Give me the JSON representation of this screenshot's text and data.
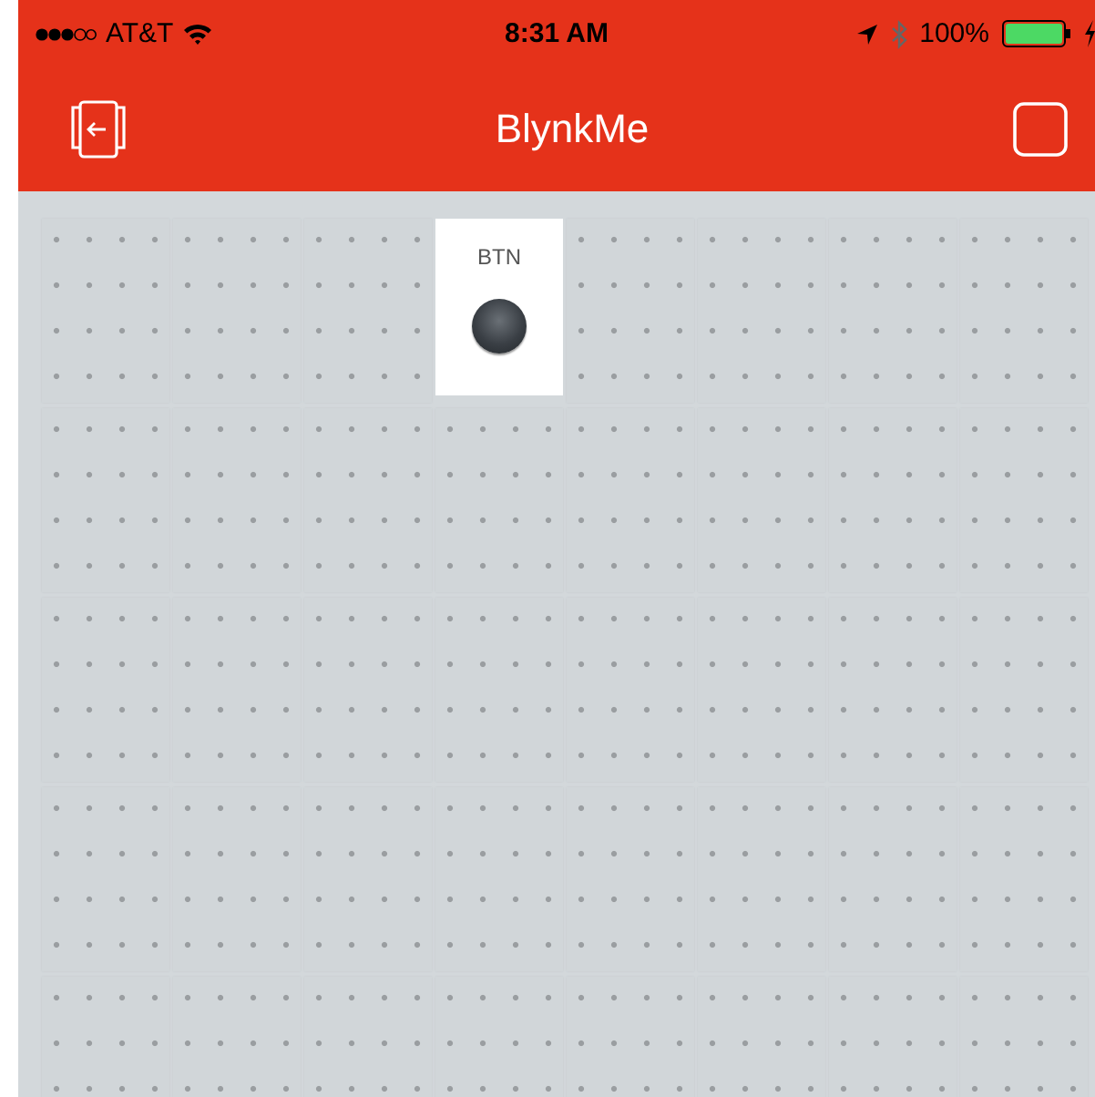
{
  "status_bar": {
    "carrier": "AT&T",
    "time": "8:31 AM",
    "battery": "100%"
  },
  "header": {
    "title": "BlynkMe"
  },
  "grid": {
    "cells": [
      {
        "kind": "empty"
      },
      {
        "kind": "empty"
      },
      {
        "kind": "empty"
      },
      {
        "kind": "button",
        "label": "BTN"
      },
      {
        "kind": "empty"
      },
      {
        "kind": "empty"
      },
      {
        "kind": "empty"
      },
      {
        "kind": "empty"
      },
      {
        "kind": "empty"
      },
      {
        "kind": "empty"
      },
      {
        "kind": "empty"
      },
      {
        "kind": "empty"
      },
      {
        "kind": "empty"
      },
      {
        "kind": "empty"
      },
      {
        "kind": "empty"
      },
      {
        "kind": "empty"
      },
      {
        "kind": "empty"
      },
      {
        "kind": "empty"
      },
      {
        "kind": "empty"
      },
      {
        "kind": "empty"
      },
      {
        "kind": "empty"
      },
      {
        "kind": "empty"
      },
      {
        "kind": "empty"
      },
      {
        "kind": "empty"
      },
      {
        "kind": "empty"
      },
      {
        "kind": "empty"
      },
      {
        "kind": "empty"
      },
      {
        "kind": "empty"
      },
      {
        "kind": "empty"
      },
      {
        "kind": "empty"
      },
      {
        "kind": "empty"
      },
      {
        "kind": "empty"
      },
      {
        "kind": "empty"
      },
      {
        "kind": "empty"
      },
      {
        "kind": "empty"
      },
      {
        "kind": "empty"
      },
      {
        "kind": "empty"
      },
      {
        "kind": "empty"
      },
      {
        "kind": "empty"
      },
      {
        "kind": "empty"
      }
    ]
  }
}
